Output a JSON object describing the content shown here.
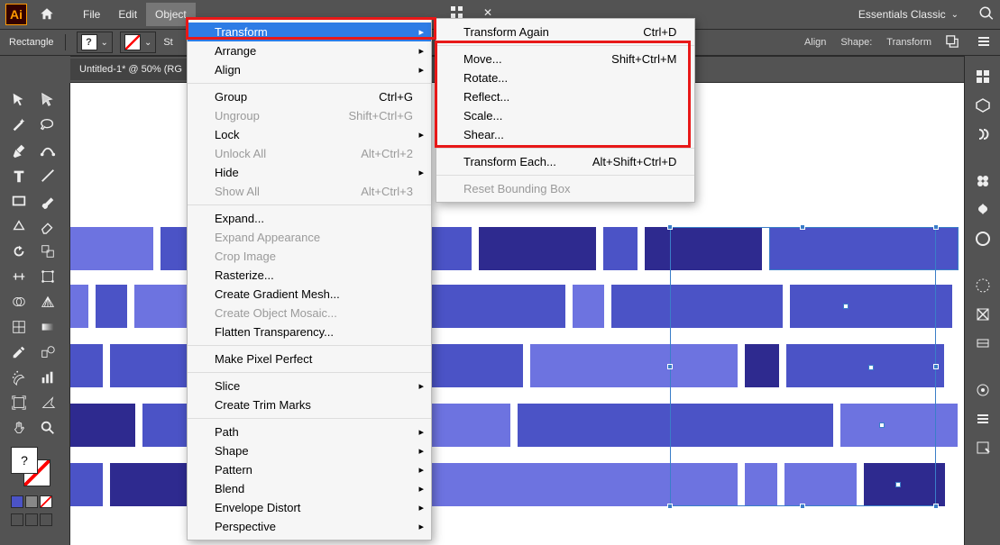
{
  "app": {
    "abbr": "Ai"
  },
  "menubar": [
    "File",
    "Edit",
    "Object"
  ],
  "active_menu_index": 2,
  "workspace": {
    "name": "Essentials Classic"
  },
  "controlbar": {
    "shape_label": "Rectangle",
    "fill_placeholder": "?",
    "stroke_label": "St",
    "align": "Align",
    "shape": "Shape:",
    "transform": "Transform"
  },
  "doc_tab": "Untitled-1* @ 50% (RG",
  "object_menu": {
    "highlight_index": 0,
    "items": [
      {
        "label": "Transform",
        "submenu": true,
        "highlight": true
      },
      {
        "label": "Arrange",
        "submenu": true
      },
      {
        "label": "Align",
        "submenu": true
      },
      {
        "sep": true
      },
      {
        "label": "Group",
        "shortcut": "Ctrl+G"
      },
      {
        "label": "Ungroup",
        "shortcut": "Shift+Ctrl+G",
        "disabled": true
      },
      {
        "label": "Lock",
        "submenu": true
      },
      {
        "label": "Unlock All",
        "shortcut": "Alt+Ctrl+2",
        "disabled": true
      },
      {
        "label": "Hide",
        "submenu": true
      },
      {
        "label": "Show All",
        "shortcut": "Alt+Ctrl+3",
        "disabled": true
      },
      {
        "sep": true
      },
      {
        "label": "Expand..."
      },
      {
        "label": "Expand Appearance",
        "disabled": true
      },
      {
        "label": "Crop Image",
        "disabled": true
      },
      {
        "label": "Rasterize..."
      },
      {
        "label": "Create Gradient Mesh..."
      },
      {
        "label": "Create Object Mosaic...",
        "disabled": true
      },
      {
        "label": "Flatten Transparency..."
      },
      {
        "sep": true
      },
      {
        "label": "Make Pixel Perfect"
      },
      {
        "sep": true
      },
      {
        "label": "Slice",
        "submenu": true
      },
      {
        "label": "Create Trim Marks"
      },
      {
        "sep": true
      },
      {
        "label": "Path",
        "submenu": true
      },
      {
        "label": "Shape",
        "submenu": true
      },
      {
        "label": "Pattern",
        "submenu": true
      },
      {
        "label": "Blend",
        "submenu": true
      },
      {
        "label": "Envelope Distort",
        "submenu": true
      },
      {
        "label": "Perspective",
        "submenu": true
      }
    ]
  },
  "transform_submenu": {
    "items": [
      {
        "label": "Transform Again",
        "shortcut": "Ctrl+D"
      },
      {
        "sep": true
      },
      {
        "label": "Move...",
        "shortcut": "Shift+Ctrl+M"
      },
      {
        "label": "Rotate..."
      },
      {
        "label": "Reflect..."
      },
      {
        "label": "Scale..."
      },
      {
        "label": "Shear..."
      },
      {
        "sep": true
      },
      {
        "label": "Transform Each...",
        "shortcut": "Alt+Shift+Ctrl+D"
      },
      {
        "sep": true
      },
      {
        "label": "Reset Bounding Box",
        "disabled": true
      }
    ]
  },
  "tools": [
    "selection-tool",
    "direct-selection-tool",
    "magic-wand-tool",
    "lasso-tool",
    "pen-tool",
    "curvature-tool",
    "type-tool",
    "line-segment-tool",
    "rectangle-tool",
    "paintbrush-tool",
    "shaper-tool",
    "eraser-tool",
    "rotate-tool",
    "scale-tool",
    "width-tool",
    "free-transform-tool",
    "shape-builder-tool",
    "perspective-grid-tool",
    "mesh-tool",
    "gradient-tool",
    "eyedropper-tool",
    "blend-tool",
    "symbol-sprayer-tool",
    "column-graph-tool",
    "artboard-tool",
    "slice-tool",
    "hand-tool",
    "zoom-tool"
  ],
  "right_panel_icons": [
    "properties-panel-icon",
    "libraries-panel-icon",
    "brushes-panel-icon",
    "swatches-panel-icon",
    "symbols-panel-icon",
    "color-panel-icon",
    "stroke-panel-icon",
    "gradient-panel-icon",
    "transparency-panel-icon",
    "appearance-panel-icon",
    "layers-panel-icon",
    "asset-export-panel-icon"
  ],
  "colors": {
    "light": "#6d73e0",
    "mid": "#4b53c6",
    "dark": "#2e2a8f"
  }
}
